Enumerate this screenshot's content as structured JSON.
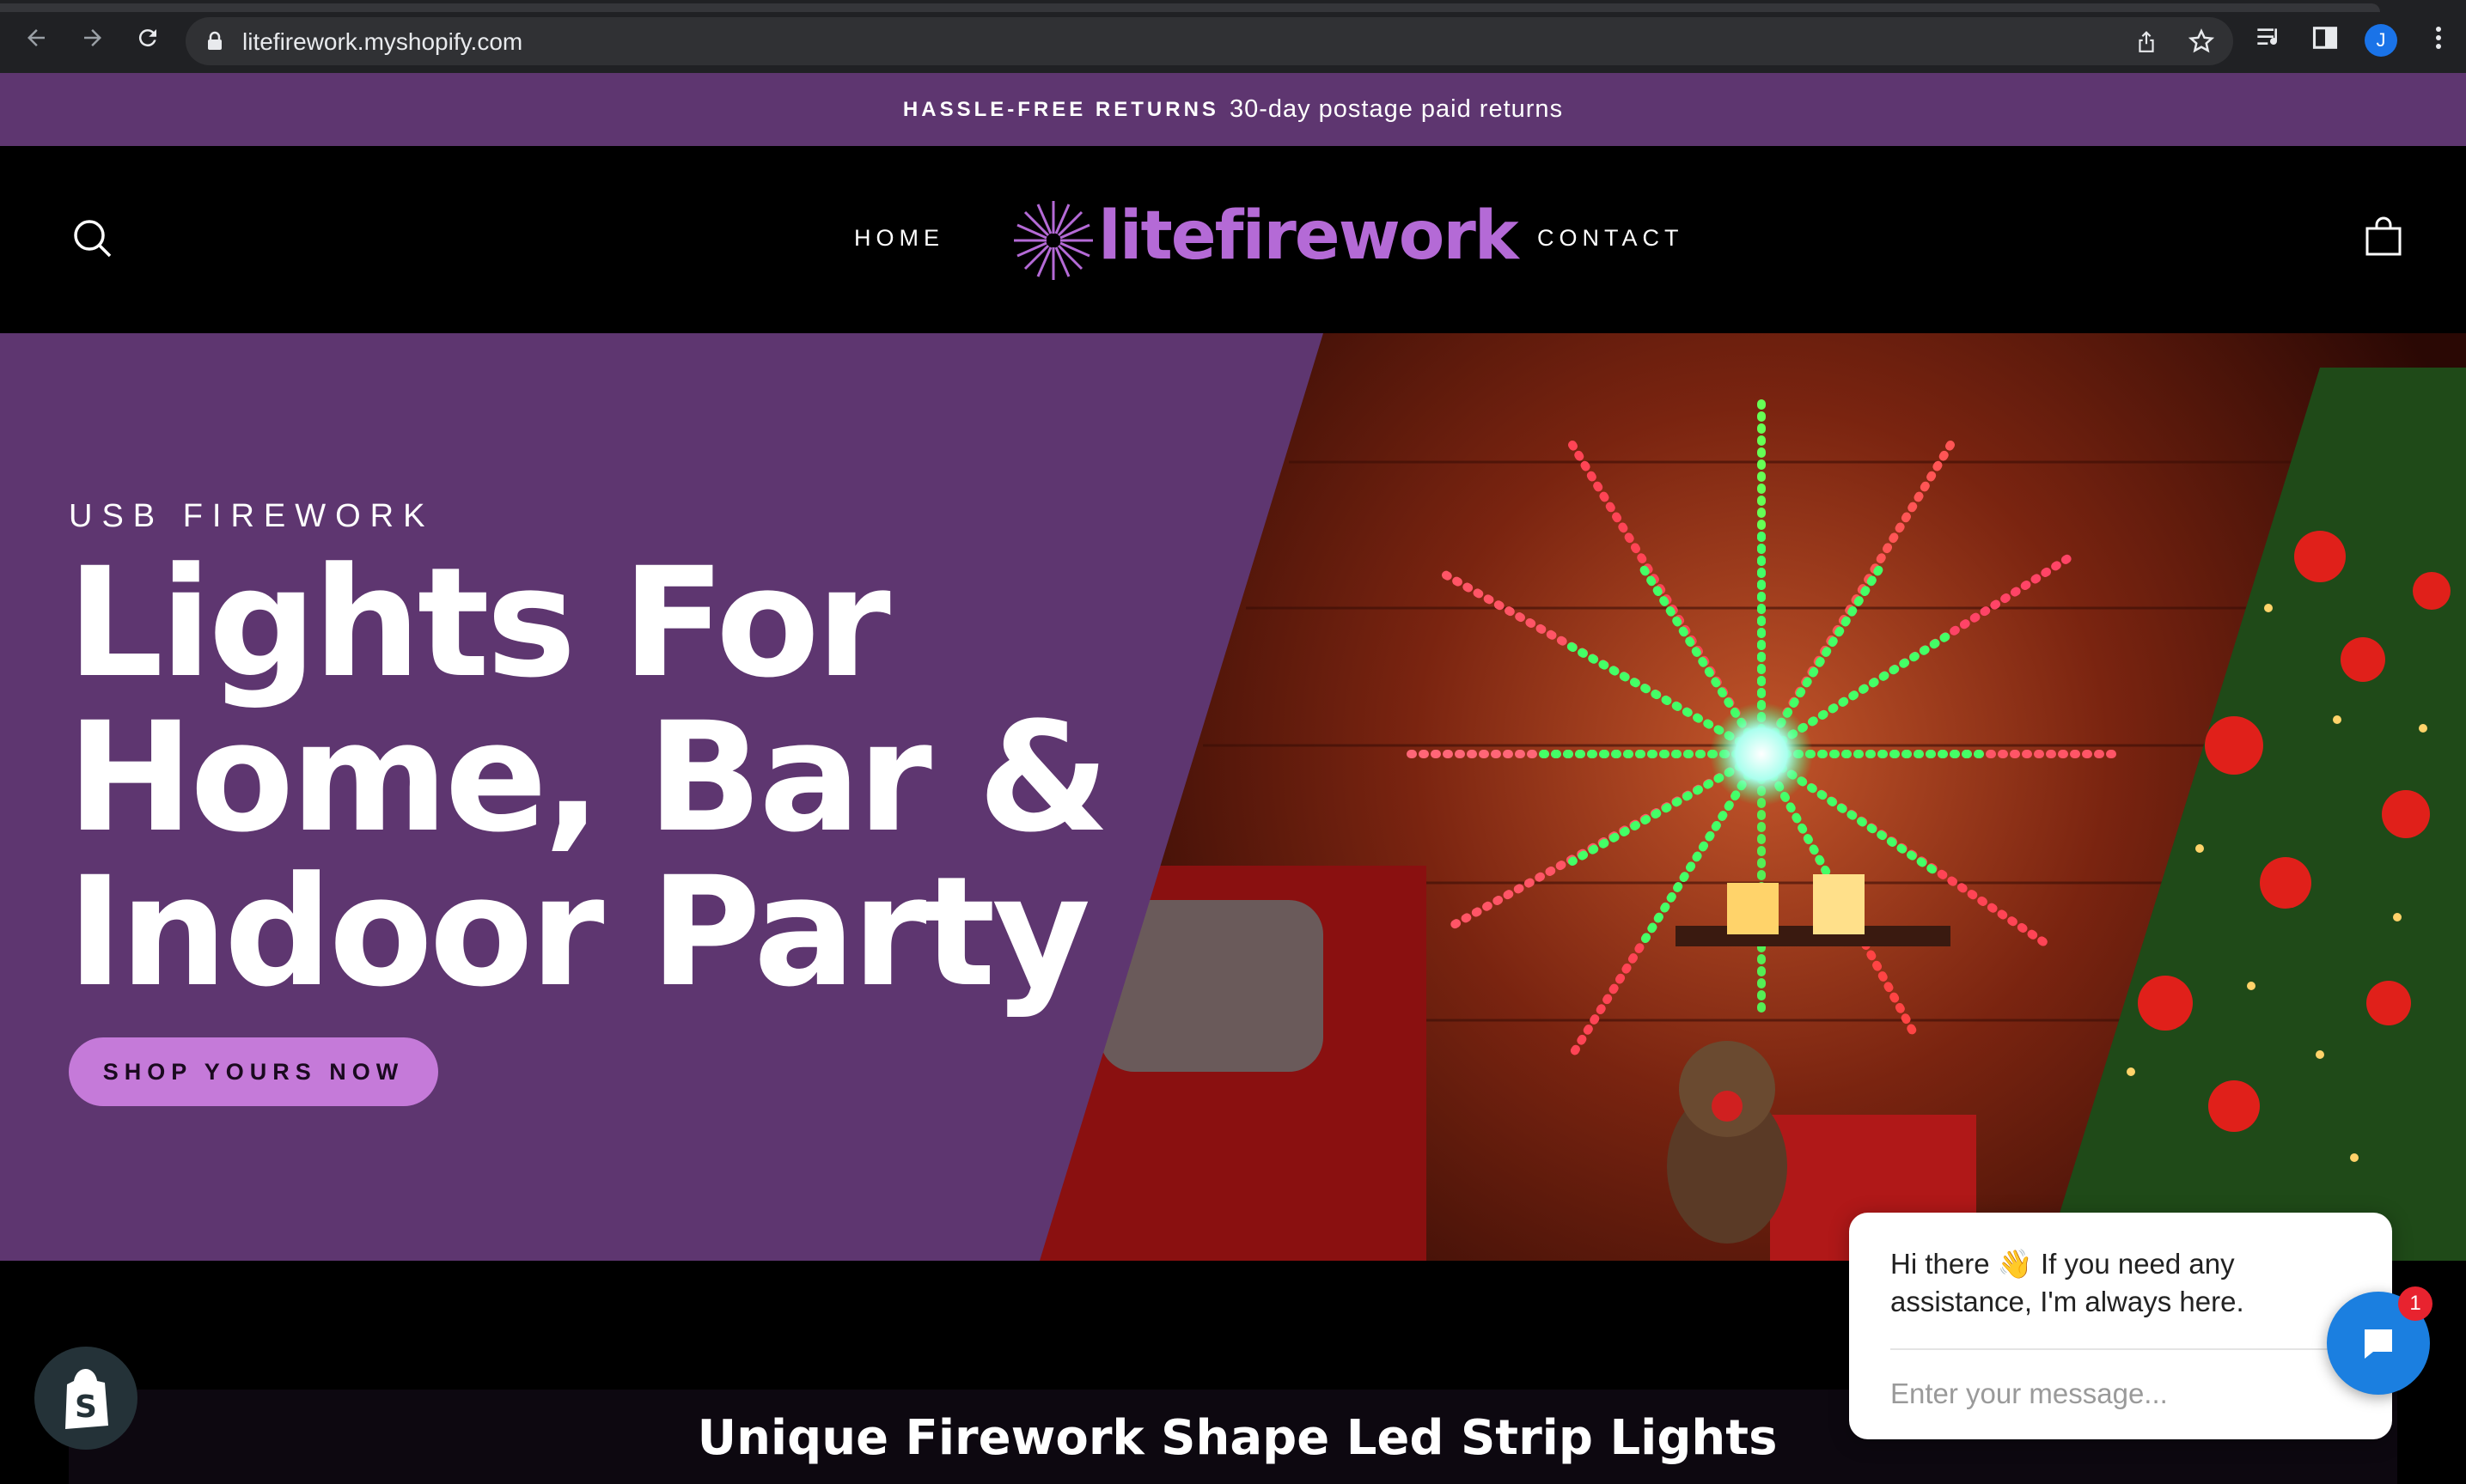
{
  "browser": {
    "url": "litefirework.myshopify.com",
    "profile_initial": "J"
  },
  "announcement": {
    "strong": "HASSLE-FREE RETURNS",
    "text": "30-day postage paid returns"
  },
  "header": {
    "nav_home": "HOME",
    "nav_contact": "CONTACT",
    "logo_text": "litefirework"
  },
  "hero": {
    "kicker": "USB FIREWORK",
    "title_line1": "Lights For",
    "title_line2": "Home, Bar &",
    "title_line3": "Indoor Party",
    "cta": "SHOP YOURS NOW"
  },
  "section": {
    "title": "Unique Firework Shape Led Strip Lights"
  },
  "chat": {
    "message": "Hi there 👋 If you need any assistance, I'm always here.",
    "placeholder": "Enter your message...",
    "badge_count": "1"
  },
  "colors": {
    "brand_purple": "#5e3670",
    "accent_lilac": "#c57ad9",
    "logo_purple": "#b46ad6",
    "chat_blue": "#1b7fe0"
  }
}
